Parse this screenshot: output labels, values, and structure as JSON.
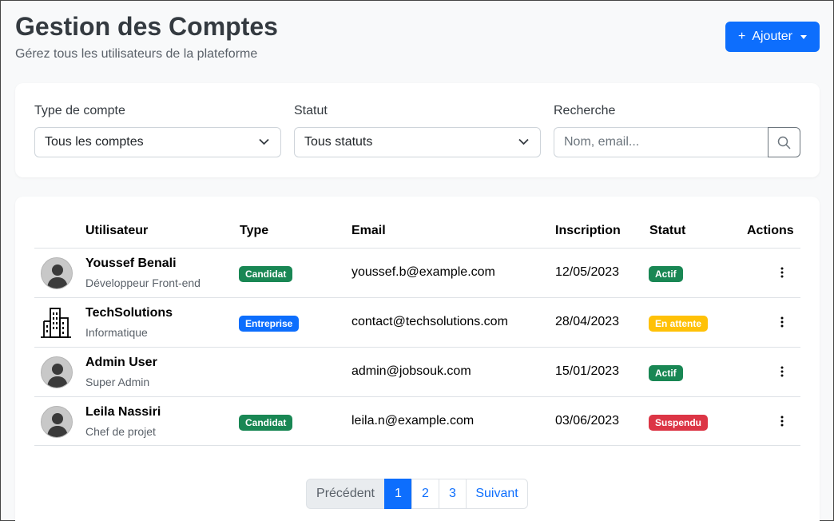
{
  "header": {
    "title": "Gestion des Comptes",
    "subtitle": "Gérez tous les utilisateurs de la plateforme",
    "add_label": "Ajouter"
  },
  "filters": {
    "type_label": "Type de compte",
    "type_value": "Tous les comptes",
    "status_label": "Statut",
    "status_value": "Tous statuts",
    "search_label": "Recherche",
    "search_placeholder": "Nom, email..."
  },
  "table": {
    "headers": [
      "Utilisateur",
      "Type",
      "Email",
      "Inscription",
      "Statut",
      "Actions"
    ],
    "rows": [
      {
        "name": "Youssef Benali",
        "role": "Développeur Front-end",
        "type": "Candidat",
        "email": "youssef.b@example.com",
        "date": "12/05/2023",
        "status": "Actif",
        "avatar": "person-icon"
      },
      {
        "name": "TechSolutions",
        "role": "Informatique",
        "type": "Entreprise",
        "email": "contact@techsolutions.com",
        "date": "28/04/2023",
        "status": "En attente",
        "avatar": "building-icon"
      },
      {
        "name": "Admin User",
        "role": "Super Admin",
        "type": "",
        "email": "admin@jobsouk.com",
        "date": "15/01/2023",
        "status": "Actif",
        "avatar": "person-icon"
      },
      {
        "name": "Leila Nassiri",
        "role": "Chef de projet",
        "type": "Candidat",
        "email": "leila.n@example.com",
        "date": "03/06/2023",
        "status": "Suspendu",
        "avatar": "person-icon"
      }
    ]
  },
  "pagination": {
    "prev_label": "Précédent",
    "pages": [
      "1",
      "2",
      "3"
    ],
    "current": "1",
    "next_label": "Suivant"
  },
  "colors": {
    "primary": "#0d6efd",
    "candidat": "#198754",
    "entreprise": "#0d6efd",
    "actif": "#198754",
    "en_attente": "#ffc107",
    "suspendu": "#dc3545"
  }
}
